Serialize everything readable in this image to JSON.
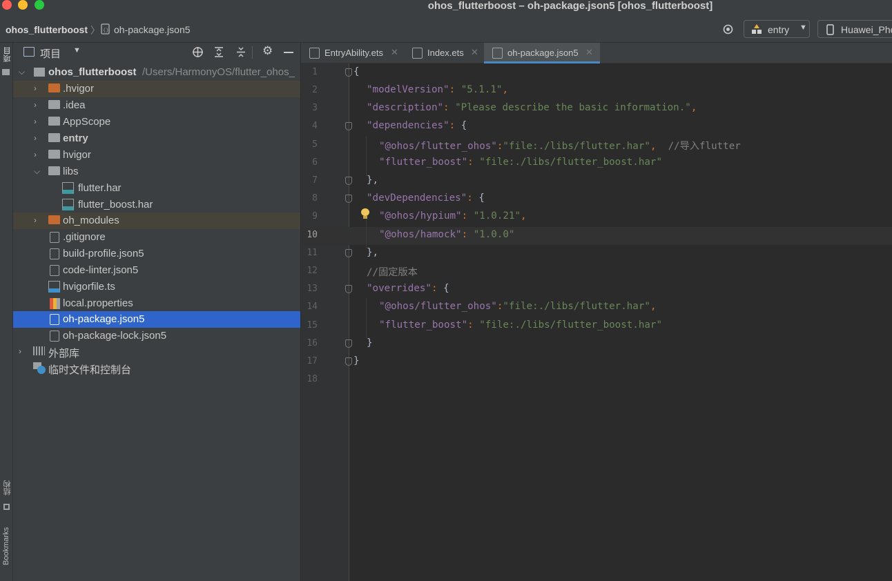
{
  "window": {
    "title": "ohos_flutterboost – oh-package.json5 [ohos_flutterboost]"
  },
  "navbar": {
    "project": "ohos_flutterboost",
    "separator": "〉",
    "file": "oh-package.json5",
    "run_config": "entry",
    "device": "Huawei_Pho"
  },
  "left_strip": {
    "top_label": "项目",
    "bottom_label1": "结构",
    "bottom_label2": "Bookmarks"
  },
  "project_panel": {
    "title": "项目",
    "root_name": "ohos_flutterboost",
    "root_path": "/Users/HarmonyOS/flutter_ohos_",
    "items": [
      {
        "label": ".hvigor",
        "type": "folder-orange",
        "expanded": false
      },
      {
        "label": ".idea",
        "type": "folder",
        "expanded": false
      },
      {
        "label": "AppScope",
        "type": "folder",
        "expanded": false
      },
      {
        "label": "entry",
        "type": "module",
        "expanded": false
      },
      {
        "label": "hvigor",
        "type": "folder",
        "expanded": false
      },
      {
        "label": "libs",
        "type": "folder",
        "expanded": true
      },
      {
        "label": "flutter.har",
        "type": "har"
      },
      {
        "label": "flutter_boost.har",
        "type": "har"
      },
      {
        "label": "oh_modules",
        "type": "folder-orange",
        "expanded": false
      },
      {
        "label": ".gitignore",
        "type": "file"
      },
      {
        "label": "build-profile.json5",
        "type": "json"
      },
      {
        "label": "code-linter.json5",
        "type": "json"
      },
      {
        "label": "hvigorfile.ts",
        "type": "ts"
      },
      {
        "label": "local.properties",
        "type": "properties"
      },
      {
        "label": "oh-package.json5",
        "type": "json",
        "selected": true
      },
      {
        "label": "oh-package-lock.json5",
        "type": "json"
      },
      {
        "label": "外部库",
        "type": "libraries"
      },
      {
        "label": "临时文件和控制台",
        "type": "scratches"
      }
    ]
  },
  "tabs": [
    {
      "label": "EntryAbility.ets",
      "active": false
    },
    {
      "label": "Index.ets",
      "active": false
    },
    {
      "label": "oh-package.json5",
      "active": true
    }
  ],
  "editor": {
    "current_line": 10,
    "line_numbers": [
      "1",
      "2",
      "3",
      "4",
      "5",
      "6",
      "7",
      "8",
      "9",
      "10",
      "11",
      "12",
      "13",
      "14",
      "15",
      "16",
      "17",
      "18"
    ],
    "lines": {
      "l1": "{",
      "l2_key": "\"modelVersion\"",
      "l2_val": "\"5.1.1\"",
      "l3_key": "\"description\"",
      "l3_val": "\"Please describe the basic information.\"",
      "l4_key": "\"dependencies\"",
      "l5_key": "\"@ohos/flutter_ohos\"",
      "l5_val": "\"file:./libs/flutter.har\"",
      "l5_comment": "//导入flutter",
      "l6_key": "\"flutter_boost\"",
      "l6_val": "\"file:./libs/flutter_boost.har\"",
      "l7": "},",
      "l8_key": "\"devDependencies\"",
      "l9_key": "\"@ohos/hypium\"",
      "l9_val": "\"1.0.21\"",
      "l10_key": "\"@ohos/hamock\"",
      "l10_val": "\"1.0.0\"",
      "l11": "},",
      "l12_comment": "//固定版本",
      "l13_key": "\"overrides\"",
      "l14_key": "\"@ohos/flutter_ohos\"",
      "l14_val": "\"file:./libs/flutter.har\"",
      "l15_key": "\"flutter_boost\"",
      "l15_val": "\"file:./libs/flutter_boost.har\"",
      "l16": "}",
      "l17": "}"
    }
  },
  "colors": {
    "key": "#9876aa",
    "string": "#6a8759",
    "comment": "#808080",
    "selection": "#2f65ca",
    "accent": "#4a88c7"
  }
}
